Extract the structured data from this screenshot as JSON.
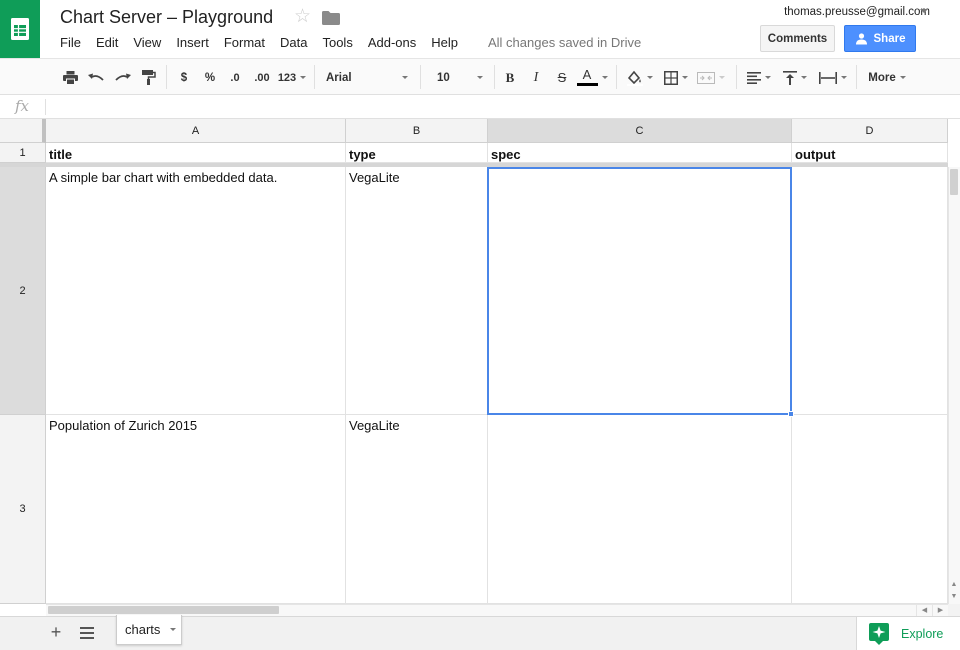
{
  "header": {
    "doc_title": "Chart Server – Playground",
    "saved_status": "All changes saved in Drive",
    "account": "thomas.preusse@gmail.com",
    "comments_label": "Comments",
    "share_label": "Share",
    "menu": [
      "File",
      "Edit",
      "View",
      "Insert",
      "Format",
      "Data",
      "Tools",
      "Add-ons",
      "Help"
    ]
  },
  "toolbar": {
    "currency": "$",
    "percent": "%",
    "decrease_decimals": ".0",
    "increase_decimals": ".00",
    "more_formats": "123",
    "font": "Arial",
    "font_size": "10",
    "bold": "B",
    "italic": "I",
    "strikethrough": "S",
    "text_color": "A",
    "more": "More"
  },
  "formula_bar": {
    "fx": "fx",
    "value": ""
  },
  "grid": {
    "columns": [
      "A",
      "B",
      "C",
      "D"
    ],
    "rows": [
      "1",
      "2",
      "3"
    ],
    "cells": [
      [
        "title",
        "type",
        "spec",
        "output"
      ],
      [
        "A simple bar chart with embedded data.",
        "VegaLite",
        "",
        ""
      ],
      [
        "Population of Zurich 2015",
        "VegaLite",
        "",
        ""
      ]
    ],
    "selected_cell": "C2"
  },
  "sheets": {
    "tabs": [
      "charts"
    ],
    "explore_label": "Explore"
  },
  "colors": {
    "brand_green": "#0f9d58",
    "share_blue": "#4d90fe",
    "selection_blue": "#4a86e8"
  },
  "icons": [
    "sheets-logo-icon",
    "star-icon",
    "folder-icon",
    "print-icon",
    "undo-icon",
    "redo-icon",
    "paint-format-icon",
    "fill-color-icon",
    "borders-icon",
    "merge-cells-icon",
    "align-left-icon",
    "valign-top-icon",
    "text-wrap-icon",
    "fx-icon",
    "add-sheet-icon",
    "all-sheets-icon",
    "explore-icon"
  ]
}
